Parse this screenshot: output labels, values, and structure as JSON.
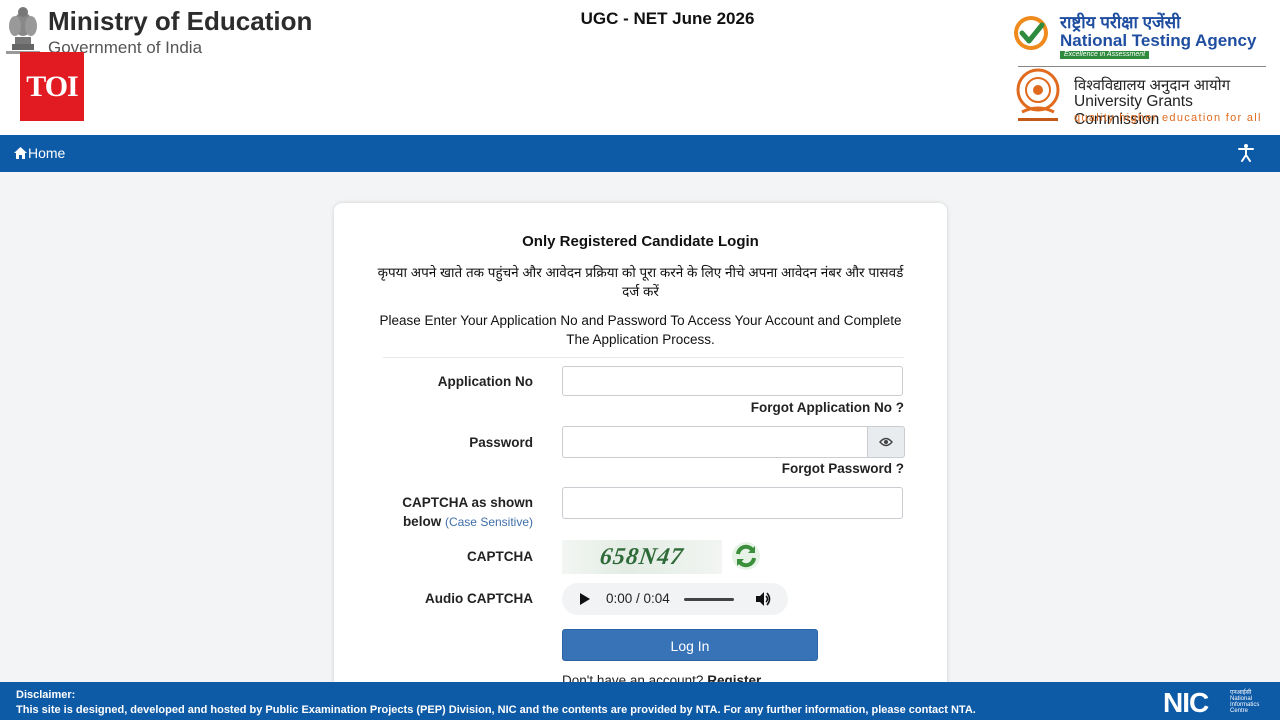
{
  "header": {
    "ministry_title": "Ministry of Education",
    "ministry_subtitle": "Government of India",
    "badge": "TOI",
    "exam_title": "UGC - NET June 2026",
    "nta": {
      "hindi": "राष्ट्रीय परीक्षा एजेंसी",
      "english": "National Testing Agency",
      "tagline": "Excellence in Assessment"
    },
    "ugc": {
      "hindi": "विश्वविद्यालय अनुदान आयोग",
      "english": "University Grants Commission",
      "tagline": "quality higher education for all"
    }
  },
  "nav": {
    "home_label": "Home",
    "icons": {
      "home": "home-icon",
      "accessibility": "accessibility-icon"
    }
  },
  "login": {
    "title": "Only Registered Candidate Login",
    "hindi_instruction": "कृपया अपने खाते तक पहुंचने और आवेदन प्रक्रिया को पूरा करने के लिए नीचे अपना आवेदन नंबर और पासवर्ड दर्ज करें",
    "english_instruction": "Please Enter Your Application No and Password To Access Your Account and Complete The Application Process.",
    "application_no_label": "Application No",
    "application_no_value": "",
    "forgot_application": "Forgot Application No ?",
    "password_label": "Password",
    "password_value": "",
    "forgot_password": "Forgot Password ?",
    "captcha_input_label": "CAPTCHA as shown below",
    "case_sensitive": "(Case Sensitive)",
    "captcha_input_value": "",
    "captcha_label": "CAPTCHA",
    "captcha_text": "658N47",
    "audio_captcha_label": "Audio CAPTCHA",
    "audio_time": "0:00 / 0:04",
    "login_button": "Log In",
    "no_account_text": "Don't have an account?",
    "register_link": "Register"
  },
  "footer": {
    "disclaimer_label": "Disclaimer:",
    "disclaimer_text": "This site is designed, developed and hosted by Public Examination Projects (PEP) Division, NIC and the contents are provided by NTA. For any further information, please contact NTA.",
    "nic_logo": "NIC",
    "nic_hindi": "एनआईसी",
    "nic_line1": "National",
    "nic_line2": "Informatics",
    "nic_line3": "Centre"
  },
  "colors": {
    "nav_blue": "#0d5aa7",
    "button_blue": "#3873b8",
    "toi_red": "#e21b22",
    "captcha_green": "#2f6b39"
  }
}
